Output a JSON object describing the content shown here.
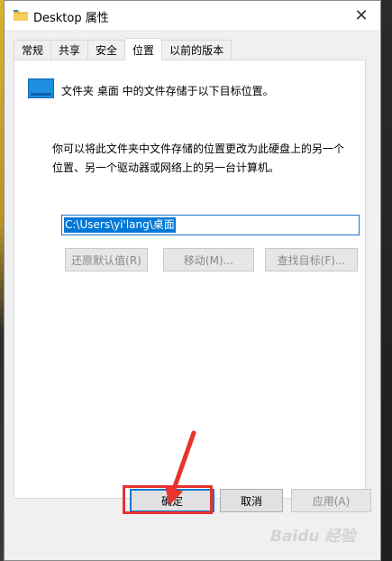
{
  "window": {
    "title": "Desktop 属性",
    "close_glyph": "✕"
  },
  "tabs": [
    {
      "label": "常规"
    },
    {
      "label": "共享"
    },
    {
      "label": "安全"
    },
    {
      "label": "位置",
      "active": true
    },
    {
      "label": "以前的版本"
    }
  ],
  "panel": {
    "line1": "文件夹 桌面 中的文件存储于以下目标位置。",
    "line2": "你可以将此文件夹中文件存储的位置更改为此硬盘上的另一个位置、另一个驱动器或网络上的另一台计算机。",
    "path_value": "C:\\Users\\yi'lang\\桌面",
    "buttons": {
      "restore": "还原默认值(R)",
      "move": "移动(M)...",
      "find": "查找目标(F)..."
    }
  },
  "dialog_buttons": {
    "ok": "确定",
    "cancel": "取消",
    "apply": "应用(A)"
  },
  "watermark": "Baidu 经验",
  "colors": {
    "accent": "#0078d7",
    "highlight_red": "#e8332f",
    "folder_blue": "#1e8fe0"
  }
}
